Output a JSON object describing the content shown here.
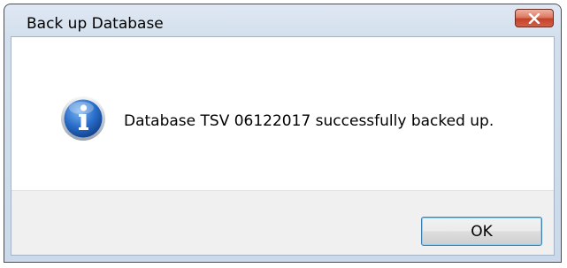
{
  "window": {
    "title": "Back up Database"
  },
  "dialog": {
    "icon": "info-icon",
    "message": "Database TSV 06122017 successfully backed up.",
    "ok_label": "OK"
  },
  "colors": {
    "close_button": "#c5402a",
    "ok_border": "#3c7fb1",
    "info_icon": "#1f5fb8"
  }
}
